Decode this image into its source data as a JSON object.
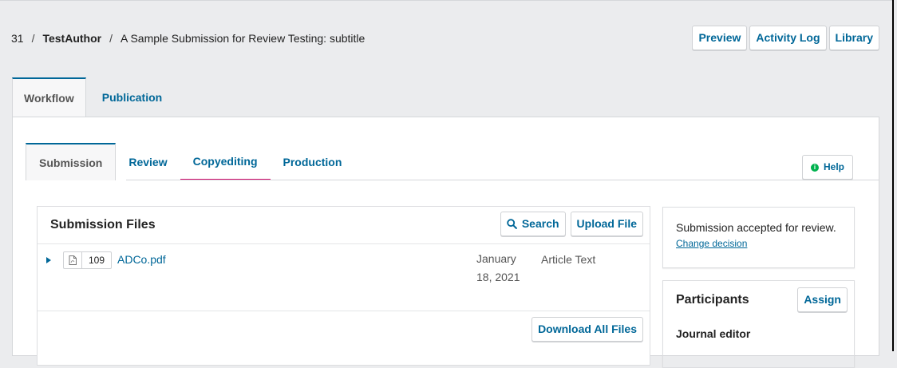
{
  "breadcrumb": {
    "id": "31",
    "author": "TestAuthor",
    "title": "A Sample Submission for Review Testing: subtitle"
  },
  "header_actions": {
    "preview": "Preview",
    "activity_log": "Activity Log",
    "library": "Library"
  },
  "main_tabs": [
    {
      "label": "Workflow",
      "active": true
    },
    {
      "label": "Publication",
      "active": false
    }
  ],
  "stage_tabs": [
    {
      "label": "Submission",
      "active": true
    },
    {
      "label": "Review",
      "active": false
    },
    {
      "label": "Copyediting",
      "active": false
    },
    {
      "label": "Production",
      "active": false
    }
  ],
  "help": {
    "label": "Help",
    "icon": "info-icon"
  },
  "files": {
    "title": "Submission Files",
    "search_label": "Search",
    "upload_label": "Upload File",
    "download_all_label": "Download All Files",
    "rows": [
      {
        "id": "109",
        "name": "ADCo.pdf",
        "date": "January 18, 2021",
        "type": "Article Text"
      }
    ]
  },
  "decision": {
    "text": "Submission accepted for review.",
    "change_link": "Change decision"
  },
  "participants": {
    "title": "Participants",
    "assign_label": "Assign",
    "roles": [
      "Journal editor"
    ]
  },
  "colors": {
    "accent": "#006798",
    "copyediting_highlight": "#d00a6c",
    "help_icon": "#00b24e"
  }
}
